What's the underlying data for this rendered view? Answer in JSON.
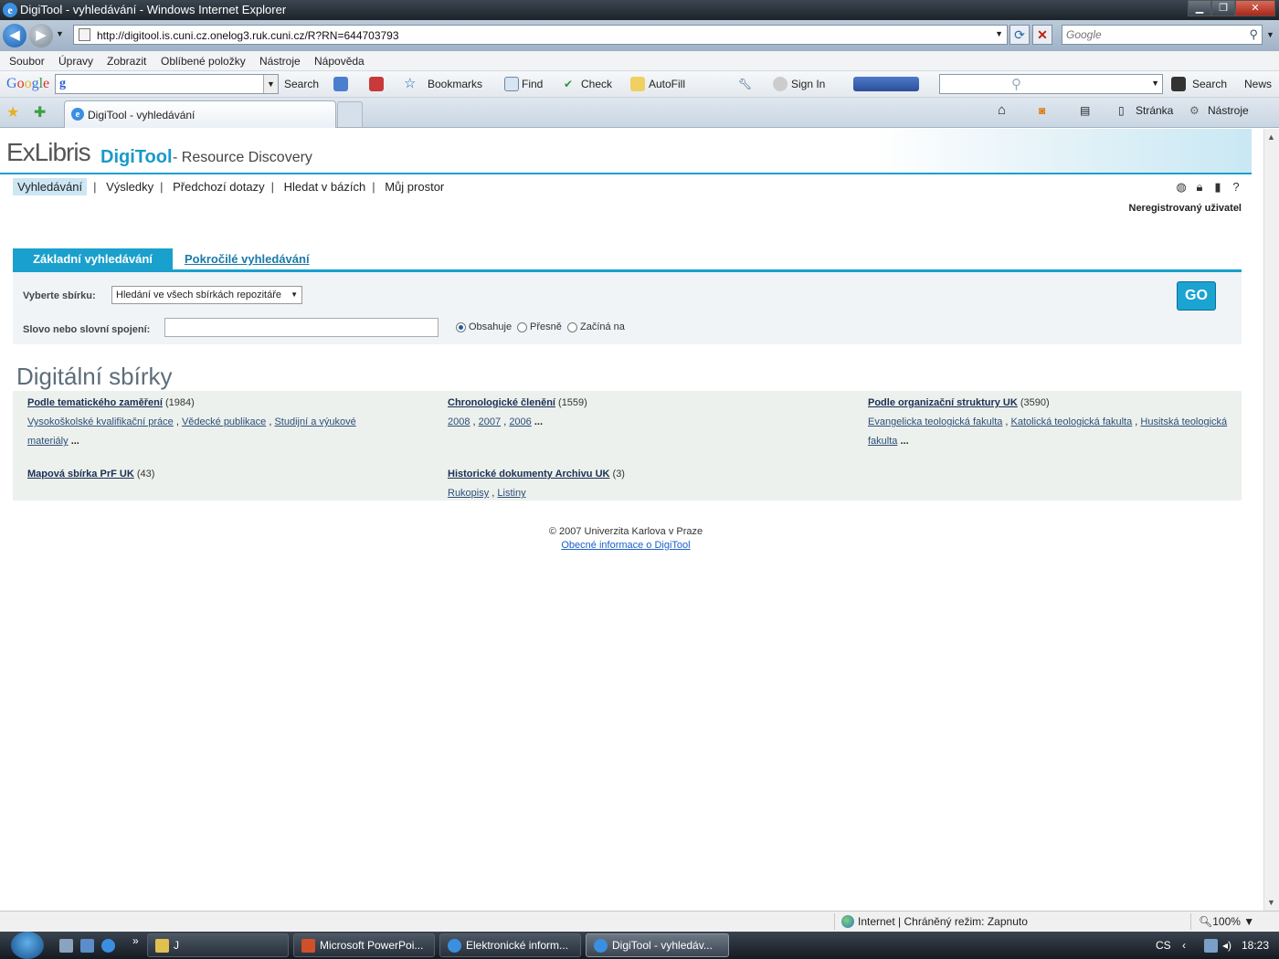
{
  "window": {
    "title": "DigiTool - vyhledávání - Windows Internet Explorer"
  },
  "address": {
    "url": "http://digitool.is.cuni.cz.onelog3.ruk.cuni.cz/R?RN=644703793",
    "search_placeholder": "Google"
  },
  "menu": [
    "Soubor",
    "Úpravy",
    "Zobrazit",
    "Oblíbené položky",
    "Nástroje",
    "Nápověda"
  ],
  "toolbar": {
    "google_search": "Search",
    "bookmarks": "Bookmarks",
    "find": "Find",
    "check": "Check",
    "autofill": "AutoFill",
    "sign_in": "Sign In",
    "search": "Search",
    "news": "News"
  },
  "tabs": {
    "active_tab": "DigiTool - vyhledávání",
    "page_menu": "Stránka",
    "tools_menu": "Nástroje"
  },
  "page": {
    "logo_exlibris": "ExLibris",
    "logo_digitool": "DigiTool",
    "logo_tagline": "- Resource Discovery",
    "nav": [
      "Vyhledávání",
      "Výsledky",
      "Předchozí dotazy",
      "Hledat v bázích",
      "Můj prostor"
    ],
    "user": "Neregistrovaný uživatel",
    "search_tabs": {
      "basic": "Základní vyhledávání",
      "advanced": "Pokročilé vyhledávání"
    },
    "form": {
      "collection_label": "Vyberte sbírku:",
      "collection_value": "Hledání ve všech sbírkách repozitáře",
      "term_label": "Slovo nebo slovní spojení:",
      "term_value": "",
      "radio_contains": "Obsahuje",
      "radio_exact": "Přesně",
      "radio_starts": "Začíná na",
      "go": "GO"
    },
    "collections_title": "Digitální sbírky",
    "collections": [
      {
        "title": "Podle tematického zaměření",
        "count": "(1984)",
        "subs": [
          "Vysokoškolské kvalifikační práce",
          "Vědecké publikace",
          "Studijní a výukové",
          "materiály"
        ]
      },
      {
        "title": "Chronologické členění",
        "count": "(1559)",
        "subs": [
          "2008",
          "2007",
          "2006"
        ]
      },
      {
        "title": "Podle organizační struktury UK",
        "count": "(3590)",
        "subs": [
          "Evangelicka teologická fakulta",
          "Katolická teologická fakulta",
          "Husitská teologická",
          "fakulta"
        ]
      },
      {
        "title": "Mapová sbírka PrF UK",
        "count": "(43)",
        "subs": []
      },
      {
        "title": "Historické dokumenty Archivu UK",
        "count": "(3)",
        "subs": [
          "Rukopisy",
          "Listiny"
        ]
      }
    ],
    "more": "...",
    "footer": {
      "copyright": "© 2007 Univerzita Karlova v Praze",
      "link": "Obecné informace o DigiTool"
    }
  },
  "status": {
    "zone": "Internet | Chráněný režim: Zapnuto",
    "zoom": "100%"
  },
  "taskbar": {
    "buttons": [
      "J",
      "Microsoft PowerPoi...",
      "Elektronické inform...",
      "DigiTool - vyhledáv..."
    ],
    "lang": "CS",
    "time": "18:23"
  }
}
